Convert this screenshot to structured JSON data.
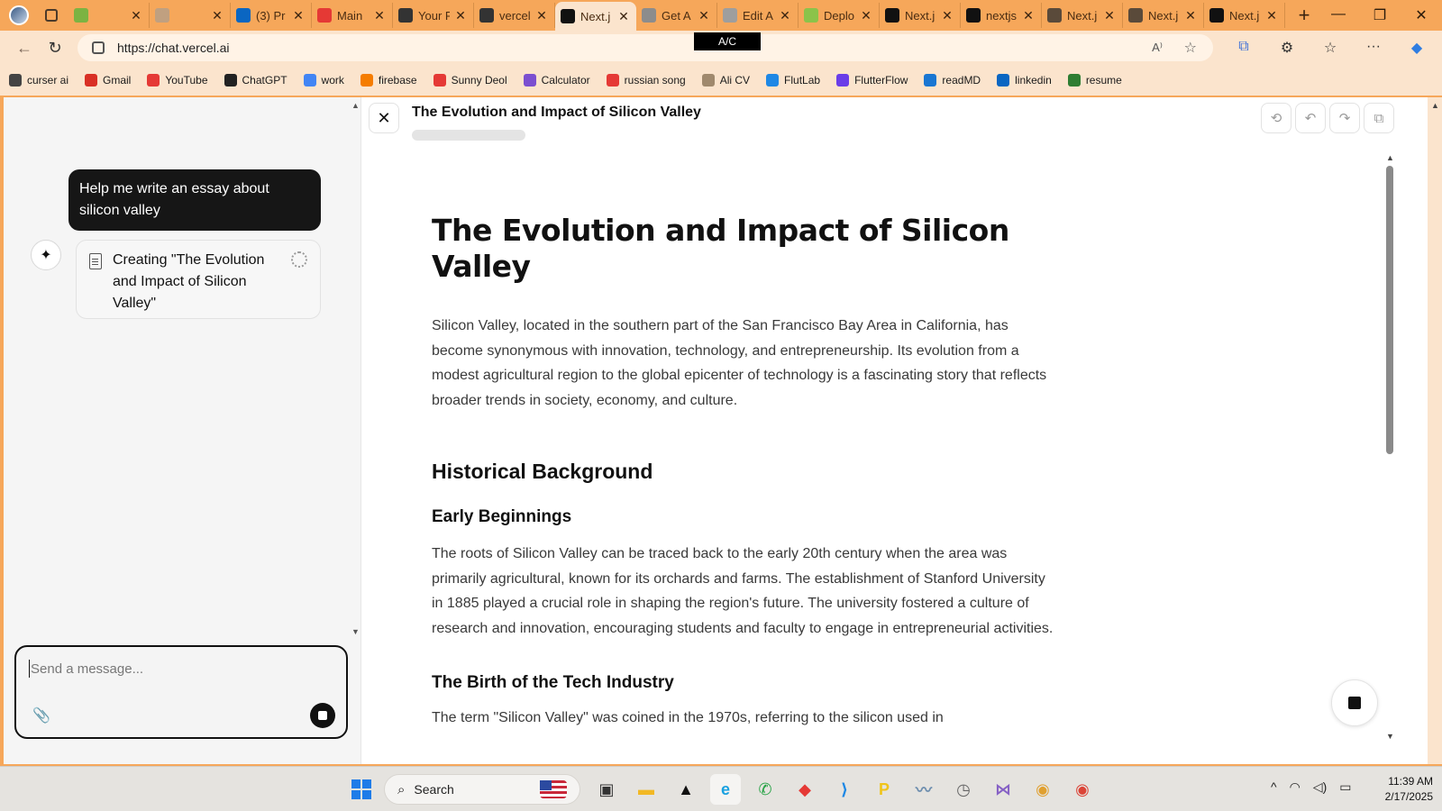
{
  "browser": {
    "tabs": [
      {
        "title": "",
        "favicon": "gadget-icon",
        "color": "#7cb342"
      },
      {
        "title": "",
        "favicon": "circle-icon",
        "color": "#c0a080"
      },
      {
        "title": "(3) Pr",
        "favicon": "linkedin-icon",
        "color": "#0a66c2"
      },
      {
        "title": "Main",
        "favicon": "youtube-icon",
        "color": "#e53935"
      },
      {
        "title": "Your F",
        "favicon": "github-icon",
        "color": "#333333"
      },
      {
        "title": "vercel",
        "favicon": "github-icon",
        "color": "#333333"
      },
      {
        "title": "Next.j",
        "favicon": "nextjs-icon",
        "color": "#111111",
        "active": true
      },
      {
        "title": "Get A",
        "favicon": "bird-icon",
        "color": "#8c8c8c"
      },
      {
        "title": "Edit A",
        "favicon": "vercel-icon",
        "color": "#9e9e9e"
      },
      {
        "title": "Deplo",
        "favicon": "deploy-icon",
        "color": "#8bc34a"
      },
      {
        "title": "Next.j",
        "favicon": "nextjs-icon",
        "color": "#111111"
      },
      {
        "title": "nextjs",
        "favicon": "vercel-triangle-icon",
        "color": "#111111"
      },
      {
        "title": "Next.j",
        "favicon": "nextjs-icon",
        "color": "#5a4a3a"
      },
      {
        "title": "Next.j",
        "favicon": "nextjs-icon",
        "color": "#5a4a3a"
      },
      {
        "title": "Next.j",
        "favicon": "nextjs-icon",
        "color": "#111111"
      }
    ],
    "new_tab": "+",
    "window_controls": {
      "minimize": "—",
      "restore": "❐",
      "close": "✕"
    },
    "url": "https://chat.vercel.ai",
    "ac_badge": "A/C",
    "bookmarks": [
      {
        "label": "curser ai",
        "icon": "cursor-icon",
        "color": "#444444"
      },
      {
        "label": "Gmail",
        "icon": "gmail-icon",
        "color": "#d93025"
      },
      {
        "label": "YouTube",
        "icon": "youtube-icon",
        "color": "#e53935"
      },
      {
        "label": "ChatGPT",
        "icon": "chatgpt-icon",
        "color": "#222222"
      },
      {
        "label": "work",
        "icon": "docs-icon",
        "color": "#4285f4"
      },
      {
        "label": "firebase",
        "icon": "firebase-icon",
        "color": "#f57c00"
      },
      {
        "label": "Sunny Deol",
        "icon": "youtube-icon",
        "color": "#e53935"
      },
      {
        "label": "Calculator",
        "icon": "calculator-icon",
        "color": "#7b4fd0"
      },
      {
        "label": "russian song",
        "icon": "youtube-icon",
        "color": "#e53935"
      },
      {
        "label": "Ali CV",
        "icon": "cv-icon",
        "color": "#a0896d"
      },
      {
        "label": "FlutLab",
        "icon": "flutlab-icon",
        "color": "#1e88e5"
      },
      {
        "label": "FlutterFlow",
        "icon": "flutterflow-icon",
        "color": "#6a3de8"
      },
      {
        "label": "readMD",
        "icon": "readmd-icon",
        "color": "#1976d2"
      },
      {
        "label": "linkedin",
        "icon": "linkedin-icon",
        "color": "#0a66c2"
      },
      {
        "label": "resume",
        "icon": "resume-icon",
        "color": "#2e7d32"
      }
    ]
  },
  "chat": {
    "user_message": "Help me write an essay about silicon valley",
    "assistant_status": "Creating \"The Evolution and Impact of Silicon Valley\"",
    "composer_placeholder": "Send a message..."
  },
  "document": {
    "header_title": "The Evolution and Impact of Silicon Valley",
    "title": "The Evolution and Impact of Silicon Valley",
    "intro": "Silicon Valley, located in the southern part of the San Francisco Bay Area in California, has become synonymous with innovation, technology, and entrepreneurship. Its evolution from a modest agricultural region to the global epicenter of technology is a fascinating story that reflects broader trends in society, economy, and culture.",
    "section1_heading": "Historical Background",
    "subsection1_heading": "Early Beginnings",
    "subsection1_text": "The roots of Silicon Valley can be traced back to the early 20th century when the area was primarily agricultural, known for its orchards and farms. The establishment of Stanford University in 1885 played a crucial role in shaping the region's future. The university fostered a culture of research and innovation, encouraging students and faculty to engage in entrepreneurial activities.",
    "subsection2_heading": "The Birth of the Tech Industry",
    "subsection2_text": "The term \"Silicon Valley\" was coined in the 1970s, referring to the silicon used in"
  },
  "taskbar": {
    "search_label": "Search",
    "apps": [
      {
        "name": "task-view-app",
        "glyph": "▣",
        "color": "#333333"
      },
      {
        "name": "file-explorer-app",
        "glyph": "▬",
        "color": "#f2b824"
      },
      {
        "name": "terminal-app",
        "glyph": "▲",
        "color": "#111111"
      },
      {
        "name": "edge-app",
        "glyph": "e",
        "color": "#1aa1e0",
        "active": true
      },
      {
        "name": "whatsapp-app",
        "glyph": "✆",
        "color": "#25a244"
      },
      {
        "name": "anydesk-app",
        "glyph": "◆",
        "color": "#e53935"
      },
      {
        "name": "vscode-app",
        "glyph": "⟩",
        "color": "#1e88e5"
      },
      {
        "name": "app-p",
        "glyph": "P",
        "color": "#f0c419"
      },
      {
        "name": "activity-app",
        "glyph": "〰",
        "color": "#6f8faf"
      },
      {
        "name": "clock-app",
        "glyph": "◷",
        "color": "#666666"
      },
      {
        "name": "visual-studio-app",
        "glyph": "⋈",
        "color": "#8661c5"
      },
      {
        "name": "chrome-canary-app",
        "glyph": "◉",
        "color": "#e0a030"
      },
      {
        "name": "chrome-app",
        "glyph": "◉",
        "color": "#db4437"
      }
    ],
    "tray": {
      "chevron": "^",
      "wifi": "wifi-icon",
      "volume": "volume-icon",
      "battery": "battery-icon"
    },
    "time": "11:39 AM",
    "date": "2/17/2025"
  }
}
